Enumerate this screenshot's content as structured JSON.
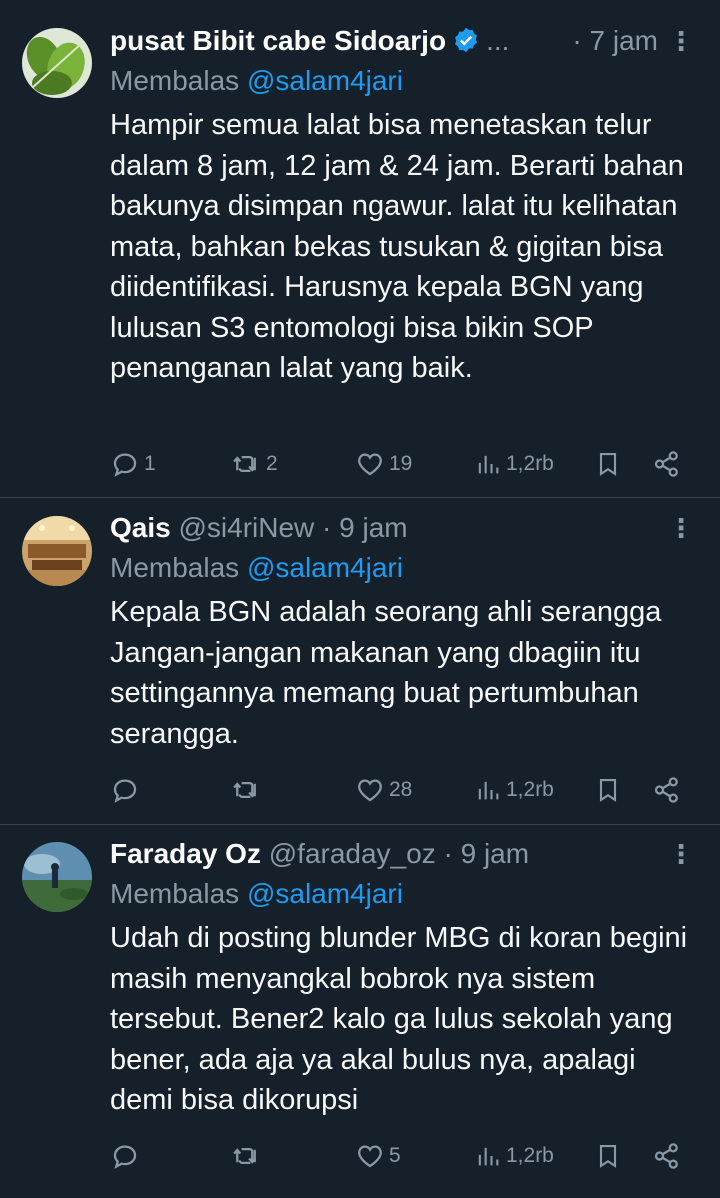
{
  "tweets": [
    {
      "name": "pusat Bibit cabe Sidoarjo",
      "verified": true,
      "name_truncated": "...",
      "handle": "",
      "time": "· 7 jam",
      "reply_prefix": "Membalas",
      "reply_to": "@salam4jari",
      "text": "Hampir semua lalat bisa menetaskan telur dalam 8 jam, 12 jam & 24 jam. Berarti bahan bakunya disimpan ngawur. lalat itu kelihatan mata, bahkan bekas tusukan & gigitan bisa diidentifikasi. Harusnya kepala BGN yang lulusan S3 entomologi bisa bikin SOP penanganan lalat yang baik.",
      "replies": "1",
      "retweets": "2",
      "likes": "19",
      "views": "1,2rb"
    },
    {
      "name": "Qais",
      "verified": false,
      "handle": "@si4riNew",
      "time": "· 9 jam",
      "reply_prefix": "Membalas",
      "reply_to": "@salam4jari",
      "text": "Kepala BGN adalah seorang ahli serangga Jangan-jangan makanan yang dbagiin itu settingannya memang buat pertumbuhan serangga.",
      "replies": "",
      "retweets": "",
      "likes": "28",
      "views": "1,2rb"
    },
    {
      "name": "Faraday Oz",
      "verified": false,
      "handle": "@faraday_oz",
      "time": "· 9 jam",
      "reply_prefix": "Membalas",
      "reply_to": "@salam4jari",
      "text": "Udah di posting blunder MBG di koran begini masih menyangkal bobrok nya sistem tersebut. Bener2 kalo ga lulus sekolah yang bener, ada aja ya akal bulus nya, apalagi demi bisa dikorupsi",
      "replies": "",
      "retweets": "",
      "likes": "5",
      "views": "1,2rb"
    }
  ],
  "icons": {
    "more": "more-vertical-icon",
    "reply": "reply-icon",
    "retweet": "retweet-icon",
    "like": "heart-icon",
    "views": "views-icon",
    "bookmark": "bookmark-icon",
    "share": "share-icon",
    "verified": "verified-badge-icon"
  },
  "colors": {
    "background": "#15202b",
    "text": "#f7f9f9",
    "muted": "#8b98a5",
    "link": "#1d9bf0",
    "divider": "#38444d"
  }
}
